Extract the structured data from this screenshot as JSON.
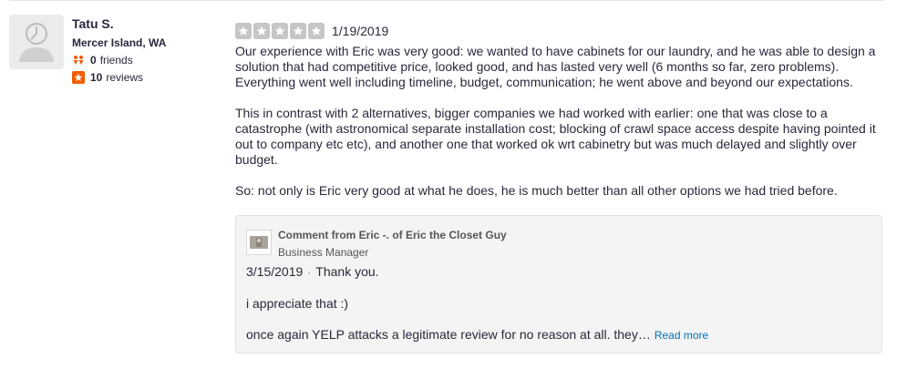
{
  "user": {
    "name": "Tatu S.",
    "location": "Mercer Island, WA",
    "friends_count": "0",
    "friends_label": "friends",
    "reviews_count": "10",
    "reviews_label": "reviews",
    "avatar_icon": "default-user-avatar-icon",
    "friends_icon": "friends-icon",
    "reviews_icon": "review-star-icon"
  },
  "review": {
    "rating": 5,
    "max_rating": 5,
    "date": "1/19/2019",
    "paragraphs": [
      "Our experience with Eric was very good: we wanted to have cabinets for our laundry, and he was able to design a solution that had competitive price, looked good, and has lasted very well (6 months so far, zero problems). Everything went well including timeline, budget, communication; he went above and beyond our expectations.",
      "This in contrast with 2 alternatives, bigger companies we had worked with earlier: one that was close to a catastrophe (with astronomical separate installation cost; blocking of crawl space access despite having pointed it out to company etc etc), and another one that worked ok wrt cabinetry but was much delayed and slightly over budget.",
      "So: not only is Eric very good at what he does, he is much better than all other options we had tried before."
    ]
  },
  "comment": {
    "title": "Comment from Eric -. of Eric the Closet Guy",
    "role": "Business Manager",
    "date": "3/15/2019",
    "separator": "·",
    "first_line": "Thank you.",
    "line2": "i appreciate that :)",
    "line3": "once again YELP attacks a legitimate review for no reason at all. they…",
    "read_more": "Read more"
  },
  "colors": {
    "star_fill": "#c6c6c6",
    "link": "#0073bb",
    "text": "#2b273c",
    "reviews_badge": "#f15c00"
  }
}
